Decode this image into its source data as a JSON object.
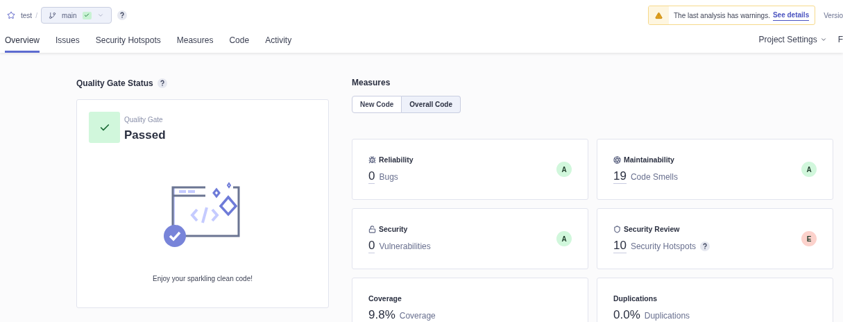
{
  "breadcrumb": {
    "project": "test",
    "separator": "/",
    "branch": "main",
    "branch_passed": true
  },
  "warning": {
    "text": "The last analysis has warnings.",
    "link": "See details"
  },
  "version_cut": "Versio",
  "tabs": [
    {
      "label": "Overview",
      "selected": true
    },
    {
      "label": "Issues",
      "selected": false
    },
    {
      "label": "Security Hotspots",
      "selected": false
    },
    {
      "label": "Measures",
      "selected": false
    },
    {
      "label": "Code",
      "selected": false
    },
    {
      "label": "Activity",
      "selected": false
    }
  ],
  "right_menu": {
    "label": "Project Settings",
    "cut": "F"
  },
  "quality_gate": {
    "title": "Quality Gate Status",
    "label": "Quality Gate",
    "status": "Passed",
    "passed": true,
    "message": "Enjoy your sparkling clean code!"
  },
  "measures": {
    "title": "Measures",
    "toggle": [
      {
        "label": "New Code",
        "selected": false
      },
      {
        "label": "Overall Code",
        "selected": true
      }
    ],
    "cards": [
      {
        "kind": "rating",
        "title": "Reliability",
        "value": "0",
        "unit": "Bugs",
        "rating": "A",
        "color": "#d1f7dc"
      },
      {
        "kind": "rating",
        "title": "Maintainability",
        "value": "19",
        "unit": "Code Smells",
        "rating": "A",
        "color": "#d1f7dc"
      },
      {
        "kind": "rating",
        "title": "Security",
        "value": "0",
        "unit": "Vulnerabilities",
        "rating": "A",
        "color": "#d1f7dc"
      },
      {
        "kind": "rating",
        "title": "Security Review",
        "value": "10",
        "unit": "Security Hotspots",
        "help": true,
        "rating": "E",
        "color": "#fcd2cc"
      },
      {
        "kind": "percent",
        "title": "Coverage",
        "value": "9.8%",
        "unit": "Coverage"
      },
      {
        "kind": "percent",
        "title": "Duplications",
        "value": "0.0%",
        "unit": "Duplications"
      }
    ]
  }
}
